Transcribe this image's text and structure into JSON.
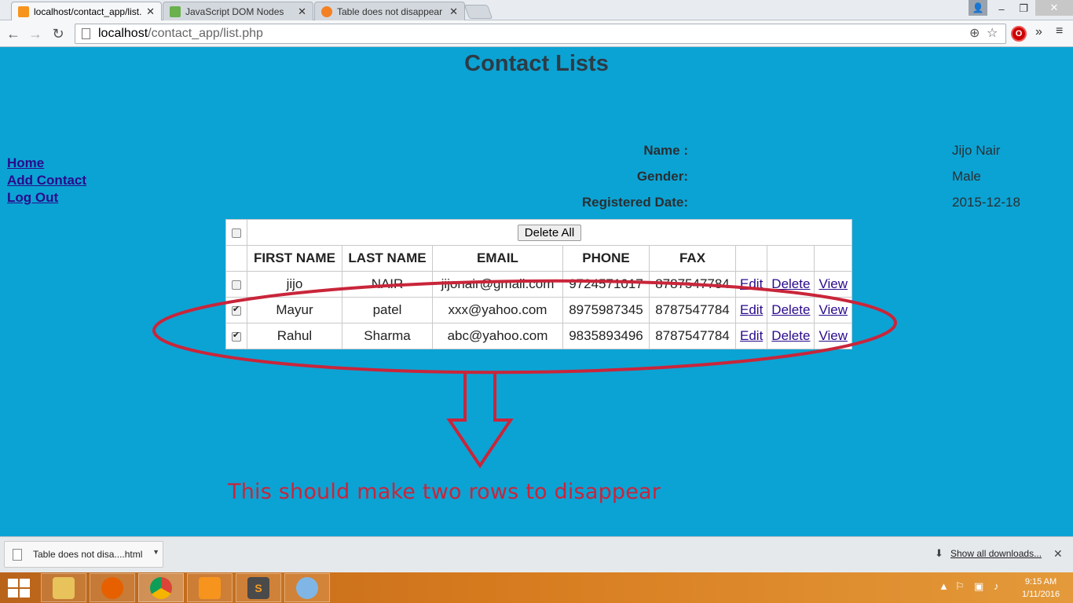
{
  "browser": {
    "tabs": [
      {
        "title": "localhost/contact_app/list.",
        "active": true,
        "favicon": "xampp-icon",
        "close": "✕"
      },
      {
        "title": "JavaScript DOM Nodes",
        "active": false,
        "favicon": "w3schools-icon",
        "close": "✕"
      },
      {
        "title": "Table does not disappear",
        "active": false,
        "favicon": "stackoverflow-icon",
        "close": "✕"
      }
    ],
    "address": {
      "host": "localhost",
      "path": "/contact_app/list.php"
    },
    "window_controls": {
      "user": "👤",
      "minimize": "–",
      "maximize": "❐",
      "close": "✕"
    }
  },
  "page": {
    "title": "Contact Lists",
    "nav_links": [
      "Home",
      "Add Contact",
      "Log Out "
    ],
    "profile": [
      {
        "label": "Name :",
        "value": "Jijo Nair"
      },
      {
        "label": "Gender:",
        "value": "Male"
      },
      {
        "label": "Registered Date:",
        "value": "2015-12-18"
      }
    ],
    "table": {
      "delete_all_label": "Delete All",
      "headers": [
        "FIRST NAME",
        "LAST NAME",
        "EMAIL",
        "PHONE",
        "FAX"
      ],
      "action_labels": {
        "edit": "Edit",
        "delete": "Delete",
        "view": "View"
      },
      "rows": [
        {
          "checked": false,
          "first": "jijo",
          "last": "NAIR",
          "email": "jijonair@gmail.com",
          "phone": "9724571017",
          "fax": "8787547784"
        },
        {
          "checked": true,
          "first": "Mayur",
          "last": "patel",
          "email": "xxx@yahoo.com",
          "phone": "8975987345",
          "fax": "8787547784"
        },
        {
          "checked": true,
          "first": "Rahul",
          "last": "Sharma",
          "email": "abc@yahoo.com",
          "phone": "9835893496",
          "fax": "8787547784"
        }
      ]
    },
    "annotation": {
      "text": "This should make two rows to disappear",
      "color": "#c9253a"
    }
  },
  "downloads": {
    "item": "Table does not disa....html",
    "show_all": "Show all downloads...",
    "close": "✕"
  },
  "taskbar": {
    "time": "9:15 AM",
    "date": "1/11/2016"
  },
  "colors": {
    "page_bg": "#0ba3d4",
    "link": "#2a0a8c"
  }
}
